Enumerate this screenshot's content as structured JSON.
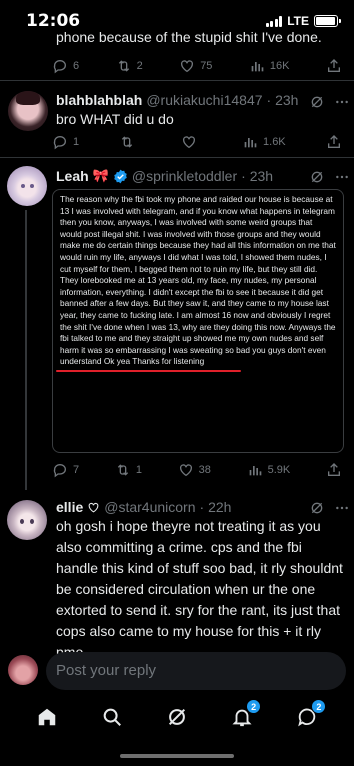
{
  "status_bar": {
    "time": "12:06",
    "network": "LTE",
    "battery_level": 0.95
  },
  "previous_reply": {
    "cut_text": "phone because of the stupid shit I've done.",
    "stats": {
      "replies": "6",
      "reposts": "2",
      "likes": "75",
      "views": "16K"
    }
  },
  "reply_1": {
    "display_name": "blahblahblah",
    "handle": "@rukiakuchi14847",
    "time": "· 23h",
    "text": "bro WHAT did u do",
    "stats": {
      "replies": "1",
      "reposts": "",
      "likes": "",
      "views": "1.6K"
    }
  },
  "reply_2": {
    "display_name": "Leah",
    "emoji": "🎀",
    "handle": "@sprinkletoddler",
    "time": "· 23h",
    "embed_text": "The reason why the fbi took my phone and raided our house is because at 13 I was involved with telegram, and if you know what happens in telegram then you know, anyways, I was involved with some weird groups that would post illegal shit. I was involved with those groups and they would make me do certain things because they had all this information on me that would ruin my life, anyways I did what I was told, I showed them nudes, I cut myself for them, I begged them not to ruin my life, but they still did. They lorebooked me at 13 years old, my face, my nudes, my personal information, everything. I didn't except the fbi to see it because it did get banned after a few days. But they saw it, and they came to my house last year, they came to fucking late. I am almost 16 now and obviously I regret the shit I've done when I was 13, why are they doing this now. Anyways the fbi talked to me and they straight up showed me my own nudes and self harm it was so embarrassing I was sweating so bad you guys don't even understand  Ok yea Thanks for listening",
    "stats": {
      "replies": "7",
      "reposts": "1",
      "likes": "38",
      "views": "5.9K"
    }
  },
  "reply_3": {
    "display_name": "ellie",
    "handle": "@star4unicorn",
    "time": "· 22h",
    "text": "oh gosh i hope theyre not treating it as you also committing a crime. cps and the fbi handle this kind of stuff soo bad, it rly shouldnt be considered circulation when ur the one extorted to send it. sry for the rant, its just that cops also came to my house for this + it rly pmo"
  },
  "composer": {
    "placeholder": "Post your reply"
  },
  "tabs": {
    "notifications_badge": "2",
    "messages_badge": "2"
  },
  "colors": {
    "background": "#000000",
    "text": "#e7e9ea",
    "muted": "#71767b",
    "accent": "#1d9bf0",
    "verified": "#1d9bf0",
    "underline": "#e0202a"
  }
}
